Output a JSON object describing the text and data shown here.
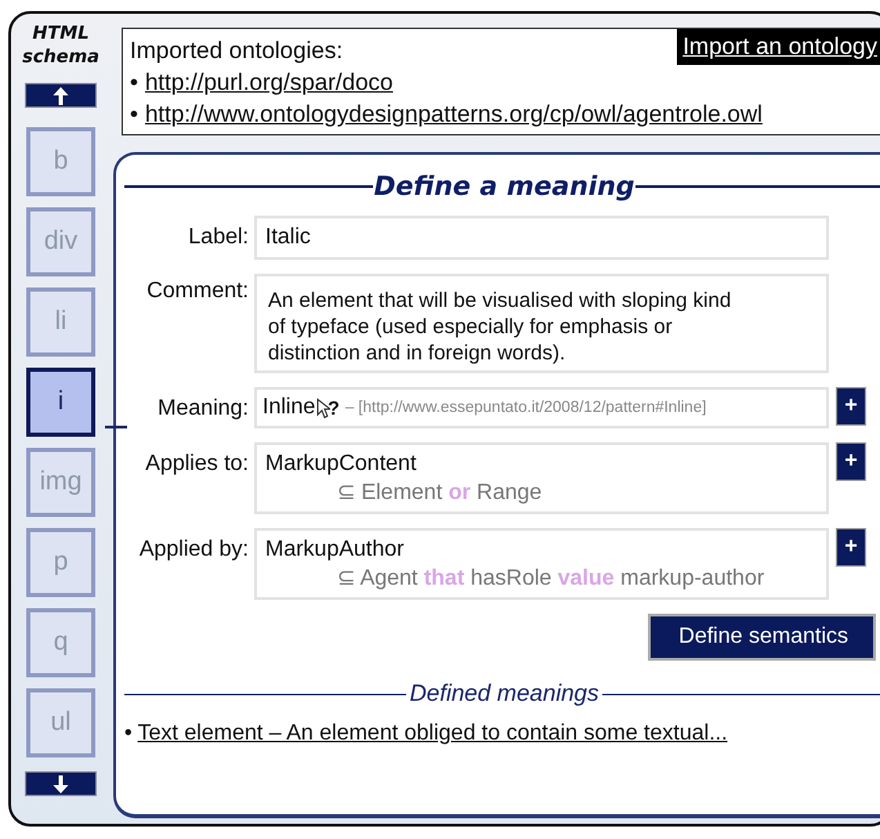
{
  "sidebar": {
    "title": "HTML schema",
    "tags": [
      {
        "label": "b",
        "selected": false
      },
      {
        "label": "div",
        "selected": false
      },
      {
        "label": "li",
        "selected": false
      },
      {
        "label": "i",
        "selected": true
      },
      {
        "label": "img",
        "selected": false
      },
      {
        "label": "p",
        "selected": false
      },
      {
        "label": "q",
        "selected": false
      },
      {
        "label": "ul",
        "selected": false
      }
    ]
  },
  "ontologies": {
    "heading": "Imported ontologies:",
    "import_button": "Import an ontology",
    "links": [
      {
        "bullet": "•",
        "url": "http://purl.org/spar/doco"
      },
      {
        "bullet": "•",
        "url": "http://www.ontologydesignpatterns.org/cp/owl/agentrole.owl"
      }
    ]
  },
  "form": {
    "title": "Define a meaning",
    "fields": [
      {
        "kind": "text",
        "label": "Label:",
        "value": "Italic"
      },
      {
        "kind": "textarea",
        "label": "Comment:",
        "value": "An element that will be visualised with sloping kind of typeface (used especially for emphasis or distinction and in foreign words)."
      },
      {
        "kind": "meaning",
        "label": "Meaning:",
        "value": "Inline",
        "hint": "?",
        "uri": "– [http://www.essepuntato.it/2008/12/pattern#Inline]",
        "add": "+"
      },
      {
        "kind": "class",
        "label": "Applies to:",
        "value": "MarkupContent",
        "expression": "⊆ Element **or** Range",
        "add": "+"
      },
      {
        "kind": "class",
        "label": "Applied by:",
        "value": "MarkupAuthor",
        "expression": "⊆ Agent **that** hasRole **value** markup-author",
        "add": "+"
      }
    ],
    "submit": "Define semantics"
  },
  "defined": {
    "title": "Defined meanings",
    "items": [
      {
        "bullet": "•",
        "text": "Text element – An element obliged to contain some textual..."
      }
    ]
  }
}
